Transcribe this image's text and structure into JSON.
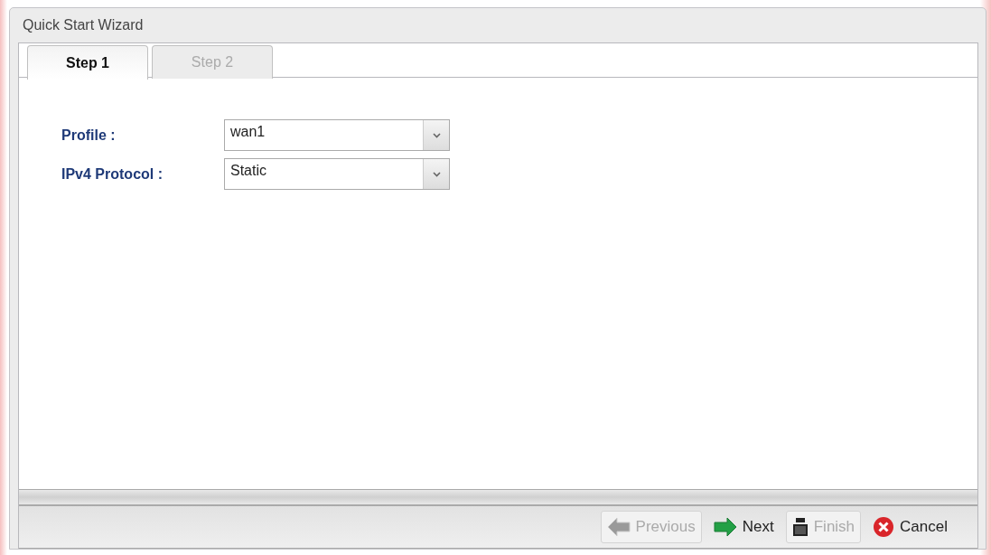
{
  "window": {
    "title": "Quick Start Wizard"
  },
  "tabs": [
    {
      "label": "Step 1",
      "selected": true
    },
    {
      "label": "Step 2",
      "selected": false
    }
  ],
  "form": [
    {
      "label": "Profile :",
      "value": "wan1"
    },
    {
      "label": "IPv4 Protocol :",
      "value": "Static"
    }
  ],
  "buttons": [
    {
      "kind": "previous",
      "label": "Previous",
      "disabled": true
    },
    {
      "kind": "next",
      "label": "Next",
      "disabled": false
    },
    {
      "kind": "finish",
      "label": "Finish",
      "disabled": true
    },
    {
      "kind": "cancel",
      "label": "Cancel",
      "disabled": false
    }
  ]
}
